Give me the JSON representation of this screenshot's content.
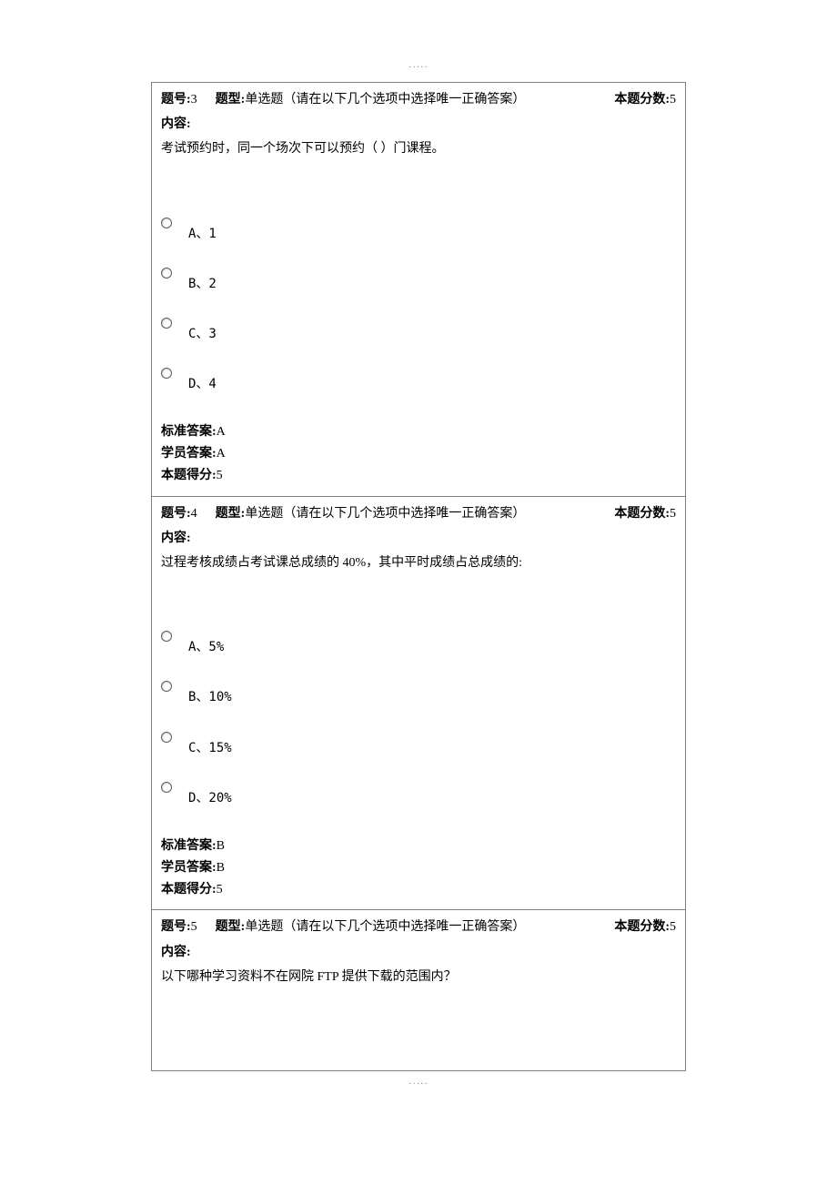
{
  "labels": {
    "question_number": "题号:",
    "question_type": "题型:",
    "question_score": "本题分数:",
    "content": "内容:",
    "standard_answer": "标准答案:",
    "student_answer": "学员答案:",
    "earned_score": "本题得分:"
  },
  "questions": [
    {
      "number": "3",
      "type": "单选题（请在以下几个选项中选择唯一正确答案）",
      "score": "5",
      "content": "考试预约时，同一个场次下可以预约（ ）门课程。",
      "options": [
        {
          "label": "A、1"
        },
        {
          "label": "B、2"
        },
        {
          "label": "C、3"
        },
        {
          "label": "D、4"
        }
      ],
      "standard_answer": "A",
      "student_answer": "A",
      "earned_score": "5",
      "show_answers": true
    },
    {
      "number": "4",
      "type": "单选题（请在以下几个选项中选择唯一正确答案）",
      "score": "5",
      "content": "过程考核成绩占考试课总成绩的 40%，其中平时成绩占总成绩的:",
      "options": [
        {
          "label": "A、5%"
        },
        {
          "label": "B、10%"
        },
        {
          "label": "C、15%"
        },
        {
          "label": "D、20%"
        }
      ],
      "standard_answer": "B",
      "student_answer": "B",
      "earned_score": "5",
      "show_answers": true
    },
    {
      "number": "5",
      "type": "单选题（请在以下几个选项中选择唯一正确答案）",
      "score": "5",
      "content": "以下哪种学习资料不在网院 FTP 提供下载的范围内？",
      "options": [],
      "standard_answer": "",
      "student_answer": "",
      "earned_score": "",
      "show_answers": false
    }
  ]
}
